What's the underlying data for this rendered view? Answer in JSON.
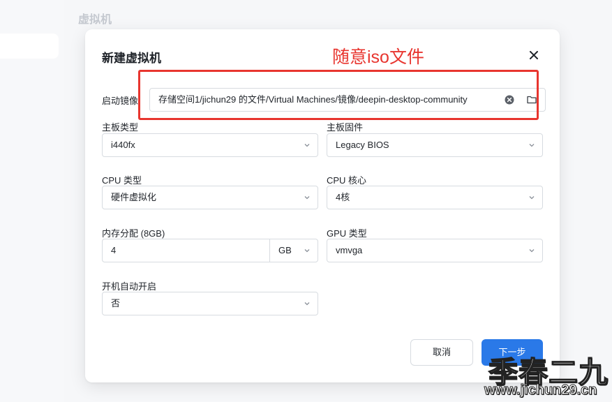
{
  "page": {
    "title": "虚拟机"
  },
  "dialog": {
    "title": "新建虚拟机",
    "boot_image": {
      "label": "启动镜像",
      "value": "存储空间1/jichun29 的文件/Virtual Machines/镜像/deepin-desktop-community"
    },
    "motherboard_type": {
      "label": "主板类型",
      "value": "i440fx"
    },
    "motherboard_firmware": {
      "label": "主板固件",
      "value": "Legacy BIOS"
    },
    "cpu_type": {
      "label": "CPU 类型",
      "value": "硬件虚拟化"
    },
    "cpu_cores": {
      "label": "CPU 核心",
      "value": "4核"
    },
    "memory": {
      "label": "内存分配 (8GB)",
      "value": "4",
      "unit": "GB"
    },
    "gpu_type": {
      "label": "GPU 类型",
      "value": "vmvga"
    },
    "autostart": {
      "label": "开机自动开启",
      "value": "否"
    },
    "buttons": {
      "cancel": "取消",
      "next": "下一步"
    }
  },
  "annotation": {
    "text": "随意iso文件",
    "color": "#e8352f"
  },
  "watermark": {
    "main": "季春二九",
    "url": "www.jichun29.cn"
  },
  "colors": {
    "primary": "#2a79e8",
    "annotation": "#e8352f"
  }
}
